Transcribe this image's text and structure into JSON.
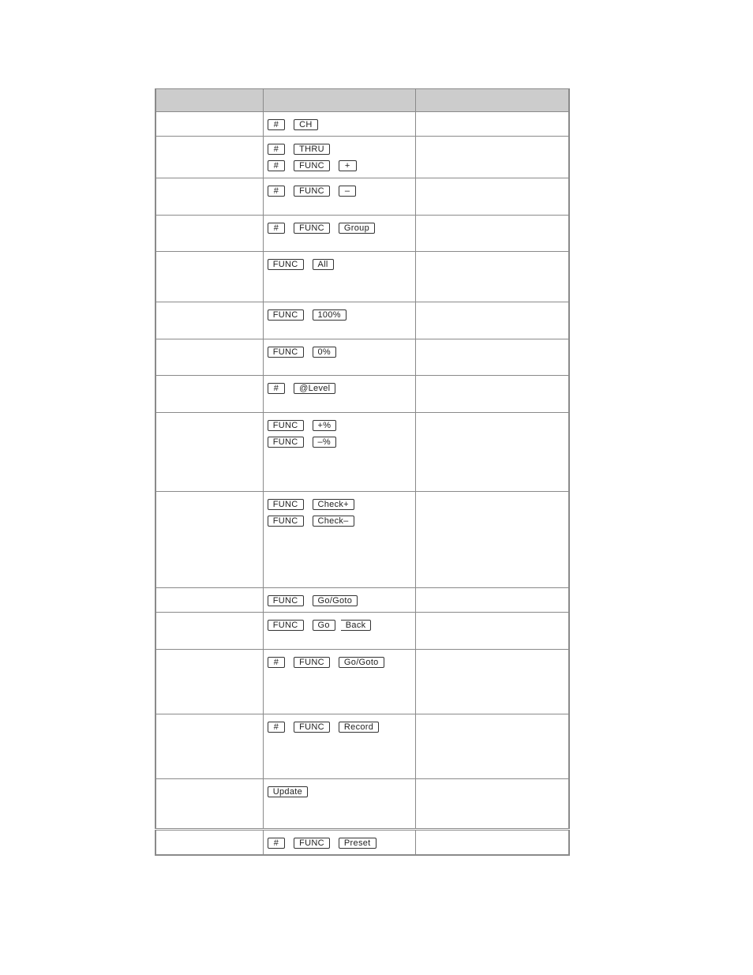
{
  "table": {
    "headers": [
      "",
      "",
      ""
    ],
    "rows": [
      {
        "label": "",
        "key_lines": [
          [
            "#",
            "CH"
          ]
        ],
        "description": ""
      },
      {
        "label": "",
        "key_lines": [
          [
            "#",
            "THRU"
          ],
          [
            "#",
            "FUNC",
            "+"
          ]
        ],
        "description": ""
      },
      {
        "label": "",
        "key_lines": [
          [
            "#",
            "FUNC",
            "–"
          ]
        ],
        "description": ""
      },
      {
        "label": "",
        "key_lines": [
          [
            "#",
            "FUNC",
            "Group"
          ]
        ],
        "description": ""
      },
      {
        "label": "",
        "key_lines": [
          [
            "FUNC",
            "All"
          ]
        ],
        "description": ""
      },
      {
        "label": "",
        "key_lines": [
          [
            "FUNC",
            "100%"
          ]
        ],
        "description": ""
      },
      {
        "label": "",
        "key_lines": [
          [
            "FUNC",
            "0%"
          ]
        ],
        "description": ""
      },
      {
        "label": "",
        "key_lines": [
          [
            "#",
            "@Level"
          ]
        ],
        "description": ""
      },
      {
        "label": "",
        "key_lines": [
          [
            "FUNC",
            "+%"
          ],
          [
            "FUNC",
            "–%"
          ]
        ],
        "description": ""
      },
      {
        "label": "",
        "key_lines": [
          [
            "FUNC",
            "Check+"
          ],
          [
            "FUNC",
            "Check–"
          ]
        ],
        "description": ""
      },
      {
        "label": "",
        "key_lines": [
          [
            "FUNC",
            "Go/Goto"
          ]
        ],
        "description": ""
      },
      {
        "label": "",
        "key_lines": [
          [
            "FUNC",
            "Go",
            "Back"
          ]
        ],
        "description": ""
      },
      {
        "label": "",
        "key_lines": [
          [
            "#",
            "FUNC",
            "Go/Goto"
          ]
        ],
        "description": ""
      },
      {
        "label": "",
        "key_lines": [
          [
            "#",
            "FUNC",
            "Record"
          ]
        ],
        "description": ""
      },
      {
        "label": "",
        "key_lines": [
          [
            "Update"
          ]
        ],
        "description": ""
      },
      {
        "label": "",
        "key_lines": [
          [
            "#",
            "FUNC",
            "Preset"
          ]
        ],
        "description": ""
      }
    ]
  }
}
